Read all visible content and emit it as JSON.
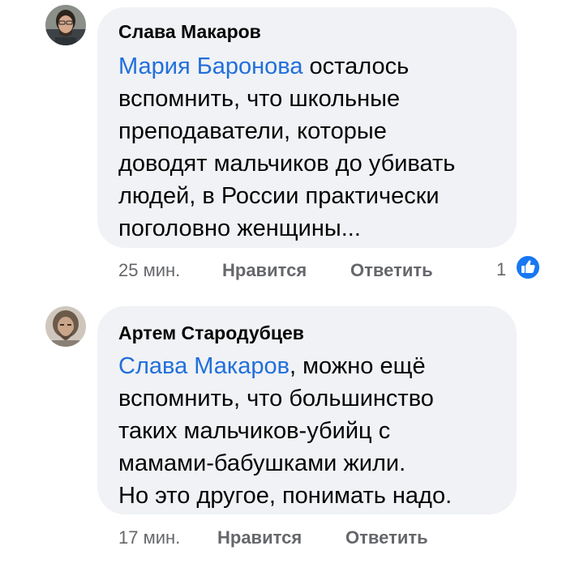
{
  "comments": [
    {
      "author": "Слава Макаров",
      "mention": "Мария Баронова",
      "text_lines": [
        " осталось",
        "вспомнить, что школьные",
        "преподаватели, которые",
        "доводят мальчиков до убивать",
        "людей, в России практически",
        "поголовно женщины..."
      ],
      "time": "25 мин.",
      "like_label": "Нравится",
      "reply_label": "Ответить",
      "reaction_count": "1",
      "reaction_icon": "like-thumbs-up-icon"
    },
    {
      "author": "Артем Стародубцев",
      "mention": "Слава Макаров",
      "text_lines": [
        ", можно ещё",
        "вспомнить, что большинство",
        "таких мальчиков-убийц с",
        "мамами-бабушками жили.",
        "Но это другое, понимать надо."
      ],
      "time": "17 мин.",
      "like_label": "Нравится",
      "reply_label": "Ответить"
    }
  ],
  "colors": {
    "bubble_bg": "#f0f2f5",
    "mention": "#216fdb",
    "meta_text": "#65676b",
    "like_blue": "#1877f2"
  }
}
